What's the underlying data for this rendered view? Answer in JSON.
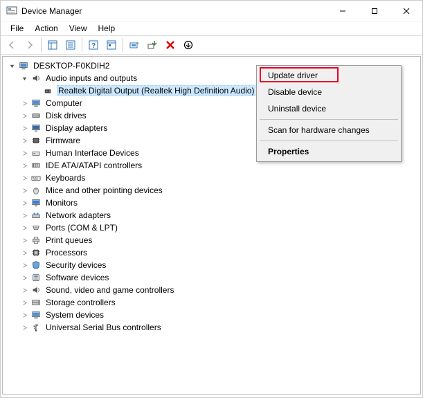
{
  "window": {
    "title": "Device Manager"
  },
  "menubar": {
    "file": "File",
    "action": "Action",
    "view": "View",
    "help": "Help"
  },
  "tree": {
    "root": "DESKTOP-F0KDIH2",
    "audio_category": "Audio inputs and outputs",
    "audio_item_selected": "Realtek Digital Output (Realtek High Definition Audio)",
    "categories": {
      "computer": "Computer",
      "disk_drives": "Disk drives",
      "display_adapters": "Display adapters",
      "firmware": "Firmware",
      "hid": "Human Interface Devices",
      "ide": "IDE ATA/ATAPI controllers",
      "keyboards": "Keyboards",
      "mice": "Mice and other pointing devices",
      "monitors": "Monitors",
      "network": "Network adapters",
      "ports": "Ports (COM & LPT)",
      "print_queues": "Print queues",
      "processors": "Processors",
      "security": "Security devices",
      "software": "Software devices",
      "sound": "Sound, video and game controllers",
      "storage": "Storage controllers",
      "system": "System devices",
      "usb": "Universal Serial Bus controllers"
    }
  },
  "context_menu": {
    "update_driver": "Update driver",
    "disable_device": "Disable device",
    "uninstall_device": "Uninstall device",
    "scan": "Scan for hardware changes",
    "properties": "Properties"
  }
}
